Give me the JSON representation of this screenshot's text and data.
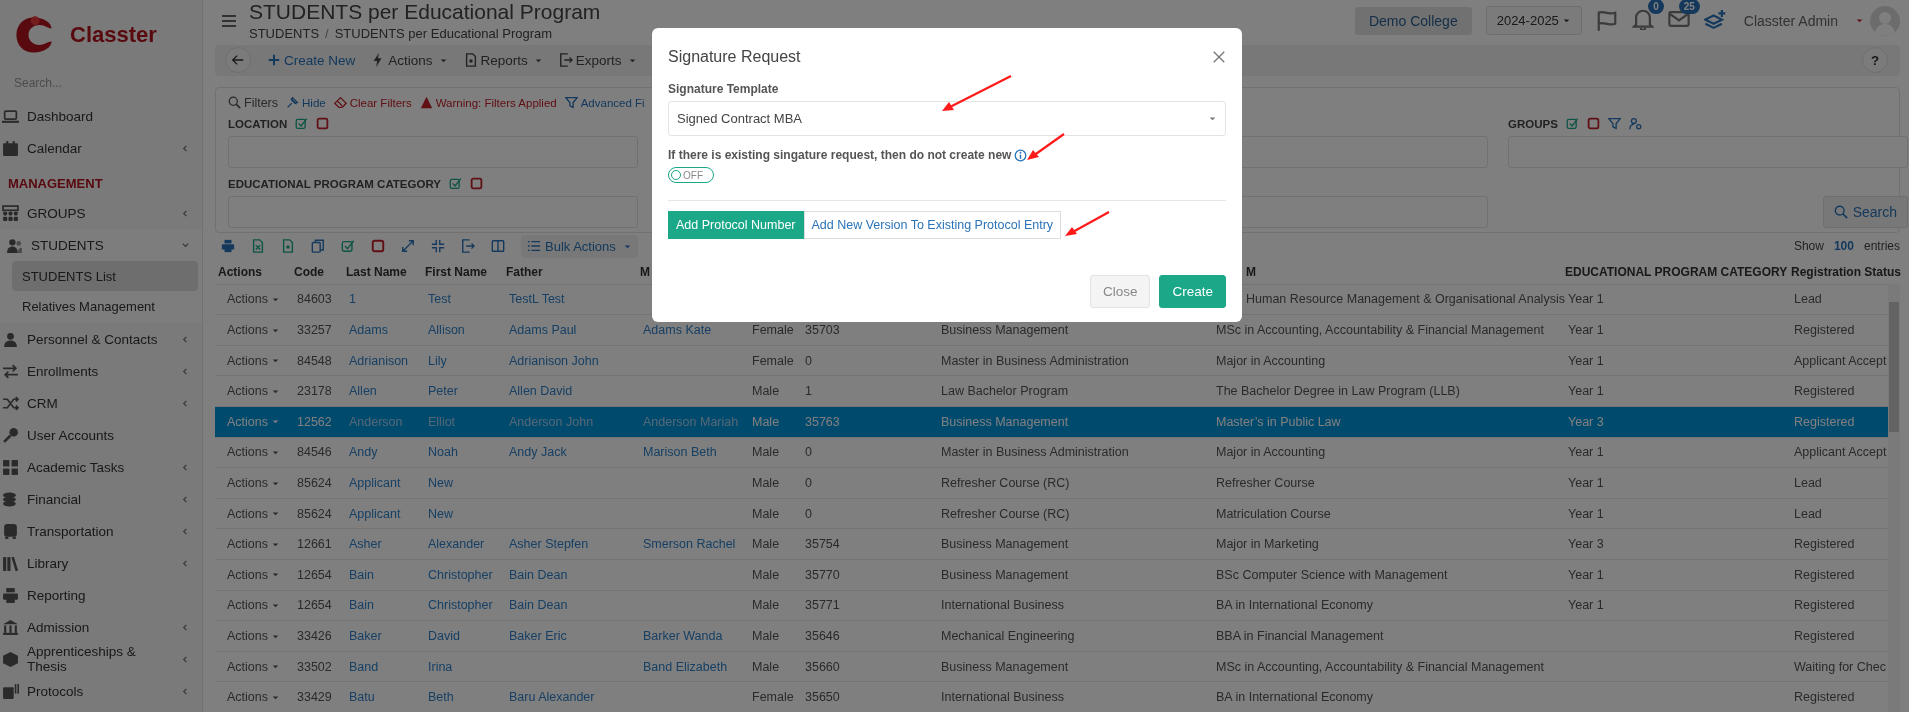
{
  "sidebar": {
    "logo": "Classter",
    "search": {
      "placeholder": "Search..."
    },
    "sections": [
      {
        "items": [
          {
            "label": "Dashboard"
          },
          {
            "label": "Calendar",
            "expanded": false
          }
        ]
      },
      {
        "title": "MANAGEMENT",
        "items": [
          {
            "label": "GROUPS",
            "expanded": false
          },
          {
            "label": "STUDENTS",
            "expanded": true,
            "children": [
              {
                "label": "STUDENTS List",
                "selected": true
              },
              {
                "label": "Relatives Management",
                "selected": false
              }
            ]
          },
          {
            "label": "Personnel & Contacts",
            "expanded": false
          },
          {
            "label": "Enrollments",
            "expanded": false
          },
          {
            "label": "CRM",
            "expanded": false
          },
          {
            "label": "User Accounts"
          },
          {
            "label": "Academic Tasks",
            "expanded": false
          },
          {
            "label": "Financial",
            "expanded": false
          },
          {
            "label": "Transportation",
            "expanded": false
          },
          {
            "label": "Library",
            "expanded": false
          },
          {
            "label": "Reporting"
          },
          {
            "label": "Admission",
            "expanded": false
          },
          {
            "label": "Apprenticeships & Thesis",
            "expanded": false
          },
          {
            "label": "Protocols",
            "expanded": false
          }
        ]
      }
    ]
  },
  "header": {
    "title": "STUDENTS per Educational Program",
    "breadcrumb": [
      "STUDENTS",
      "STUDENTS per Educational Program"
    ],
    "breadcrumb_separator": "/",
    "college": "Demo College",
    "year": "2024-2025",
    "notifications": "0",
    "messages": "25",
    "user": "Classter Admin"
  },
  "toolbar": {
    "buttons": [
      {
        "label": "Create New",
        "kind": "action"
      },
      {
        "label": "Actions",
        "kind": "menu"
      },
      {
        "label": "Reports",
        "kind": "menu"
      },
      {
        "label": "Exports",
        "kind": "menu"
      }
    ],
    "help": "?"
  },
  "filters": {
    "links": [
      {
        "label": "Filters",
        "kind": "title"
      },
      {
        "label": "Hide",
        "kind": "link"
      },
      {
        "label": "Clear Filters",
        "kind": "danger"
      },
      {
        "label": "Warning: Filters Applied",
        "kind": "warning"
      },
      {
        "label": "Advanced Fi",
        "kind": "link"
      }
    ],
    "fields": [
      {
        "kind": "select",
        "label": "LOCATION"
      },
      {
        "kind": "select"
      },
      {
        "kind": "group-select",
        "label": "GROUPS"
      },
      {
        "kind": "select",
        "label": "EDUCATIONAL PROGRAM CATEGORY"
      },
      {
        "kind": "select"
      },
      {
        "kind": "button",
        "label": "Search"
      }
    ]
  },
  "table_tools": {
    "bulk": "Bulk Actions",
    "show": "Show",
    "count": "100",
    "entries": "entries"
  },
  "table": {
    "columns": {
      "actions": "Actions",
      "code": "Code",
      "last_name": "Last Name",
      "first_name": "First Name",
      "father": "Father",
      "mother": "M",
      "ed_program": "M",
      "category": "EDUCATIONAL PROGRAM CATEGORY",
      "status": "Registration Status"
    },
    "rows": [
      {
        "selected": false,
        "actions": "Actions",
        "code": "84603",
        "last_name": "1",
        "first_name": "Test",
        "father": "TestL Test",
        "ed_program": "Human Resource Management & Organisational Analysis",
        "category": "Year 1",
        "status": "Lead"
      },
      {
        "selected": false,
        "actions": "Actions",
        "code": "33257",
        "last_name": "Adams",
        "first_name": "Allison",
        "father": "Adams Paul",
        "mother": "Adams Kate",
        "gender": "Female",
        "number": "35703",
        "program": "Business Management",
        "ed_program": "MSc in Accounting, Accountability & Financial Management",
        "category": "Year 1",
        "status": "Registered"
      },
      {
        "selected": false,
        "actions": "Actions",
        "code": "84548",
        "last_name": "Adrianison",
        "first_name": "Lily",
        "father": "Adrianison John",
        "gender": "Female",
        "number": "0",
        "program": "Master in Business Administration",
        "ed_program": "Major in Accounting",
        "category": "Year 1",
        "status": "Applicant Accept"
      },
      {
        "selected": false,
        "actions": "Actions",
        "code": "23178",
        "last_name": "Allen",
        "first_name": "Peter",
        "father": "Allen David",
        "gender": "Male",
        "number": "1",
        "program": "Law Bachelor Program",
        "ed_program": "The Bachelor Degree in Law Program (LLB)",
        "category": "Year 1",
        "status": "Registered"
      },
      {
        "selected": true,
        "actions": "Actions",
        "code": "12562",
        "last_name": "Anderson",
        "first_name": "Elliot",
        "father": "Anderson John",
        "mother": "Anderson Mariah",
        "gender": "Male",
        "number": "35763",
        "program": "Business Management",
        "ed_program": "Master’s in Public Law",
        "category": "Year 3",
        "status": "Registered"
      },
      {
        "selected": false,
        "actions": "Actions",
        "code": "84546",
        "last_name": "Andy",
        "first_name": "Noah",
        "father": "Andy Jack",
        "mother": "Marison Beth",
        "gender": "Male",
        "number": "0",
        "program": "Master in Business Administration",
        "ed_program": "Major in Accounting",
        "category": "Year 1",
        "status": "Applicant Accept"
      },
      {
        "selected": false,
        "actions": "Actions",
        "code": "85624",
        "last_name": "Applicant",
        "first_name": "New",
        "gender": "Male",
        "number": "0",
        "program": "Refresher Course (RC)",
        "ed_program": "Refresher Course",
        "category": "Year 1",
        "status": "Lead"
      },
      {
        "selected": false,
        "actions": "Actions",
        "code": "85624",
        "last_name": "Applicant",
        "first_name": "New",
        "gender": "Male",
        "number": "0",
        "program": "Refresher Course (RC)",
        "ed_program": "Matriculation Course",
        "category": "Year 1",
        "status": "Lead"
      },
      {
        "selected": false,
        "actions": "Actions",
        "code": "12661",
        "last_name": "Asher",
        "first_name": "Alexander",
        "father": "Asher Stepfen",
        "mother": "Smerson Rachel",
        "gender": "Male",
        "number": "35754",
        "program": "Business Management",
        "ed_program": "Major in Marketing",
        "category": "Year 3",
        "status": "Registered"
      },
      {
        "selected": false,
        "actions": "Actions",
        "code": "12654",
        "last_name": "Bain",
        "first_name": "Christopher",
        "father": "Bain Dean",
        "gender": "Male",
        "number": "35770",
        "program": "Business Management",
        "ed_program": "BSc Computer Science with Management",
        "category": "Year 1",
        "status": "Registered"
      },
      {
        "selected": false,
        "actions": "Actions",
        "code": "12654",
        "last_name": "Bain",
        "first_name": "Christopher",
        "father": "Bain Dean",
        "gender": "Male",
        "number": "35771",
        "program": "International Business",
        "ed_program": "BA in International Economy",
        "category": "Year 1",
        "status": "Registered"
      },
      {
        "selected": false,
        "actions": "Actions",
        "code": "33426",
        "last_name": "Baker",
        "first_name": "David",
        "father": "Baker Eric",
        "mother": "Barker Wanda",
        "gender": "Male",
        "number": "35646",
        "program": "Mechanical Engineering",
        "ed_program": "BBA in Financial Management",
        "status": "Registered"
      },
      {
        "selected": false,
        "actions": "Actions",
        "code": "33502",
        "last_name": "Band",
        "first_name": "Irina",
        "mother": "Band Elizabeth",
        "gender": "Male",
        "number": "35660",
        "program": "Business Management",
        "ed_program": "MSc in Accounting, Accountability & Financial Management",
        "status": "Waiting for Chec"
      },
      {
        "selected": false,
        "actions": "Actions",
        "code": "33429",
        "last_name": "Batu",
        "first_name": "Beth",
        "father": "Baru Alexander",
        "gender": "Female",
        "number": "35650",
        "program": "International Business",
        "ed_program": "BA in International Economy",
        "status": "Registered"
      }
    ]
  },
  "modal": {
    "title": "Signature Request",
    "template_label": "Signature Template",
    "template_value": "Signed Contract MBA",
    "option_label": "If there is existing singature request, then do not create new",
    "toggle": {
      "on": false,
      "label": "OFF"
    },
    "modes": [
      {
        "label": "Add Protocol Number",
        "selected": true
      },
      {
        "label": "Add New Version To Existing Protocol Entry",
        "selected": false
      }
    ],
    "buttons": [
      {
        "label": "Close",
        "kind": "secondary"
      },
      {
        "label": "Create",
        "kind": "primary"
      }
    ]
  }
}
